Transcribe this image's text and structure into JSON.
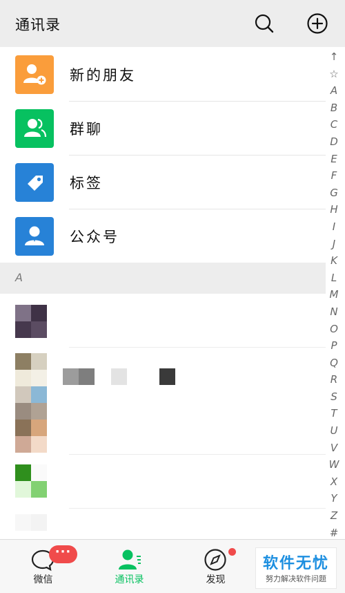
{
  "header": {
    "title": "通讯录",
    "search_icon": "search-icon",
    "add_icon": "plus-circle-icon"
  },
  "menu": [
    {
      "label": "新的朋友",
      "icon": "new-friend-icon",
      "color": "#fa9d3b"
    },
    {
      "label": "群聊",
      "icon": "group-chat-icon",
      "color": "#07c160"
    },
    {
      "label": "标签",
      "icon": "tag-icon",
      "color": "#2782d7"
    },
    {
      "label": "公众号",
      "icon": "official-account-icon",
      "color": "#2782d7"
    }
  ],
  "section": {
    "letter": "A"
  },
  "index_bar": [
    "↑",
    "☆",
    "A",
    "B",
    "C",
    "D",
    "E",
    "F",
    "G",
    "H",
    "I",
    "J",
    "K",
    "L",
    "M",
    "N",
    "O",
    "P",
    "Q",
    "R",
    "S",
    "T",
    "U",
    "V",
    "W",
    "X",
    "Y",
    "Z",
    "#"
  ],
  "tabs": [
    {
      "label": "微信",
      "icon": "chat-bubble-icon",
      "badge": "···"
    },
    {
      "label": "通讯录",
      "icon": "contacts-icon",
      "active": true
    },
    {
      "label": "发现",
      "icon": "compass-icon"
    }
  ],
  "watermark": {
    "title": "软件无忧",
    "subtitle": "努力解决软件问题"
  },
  "colors": {
    "accent": "#07c160",
    "badge": "#f04b4b",
    "header_bg": "#ededed"
  }
}
